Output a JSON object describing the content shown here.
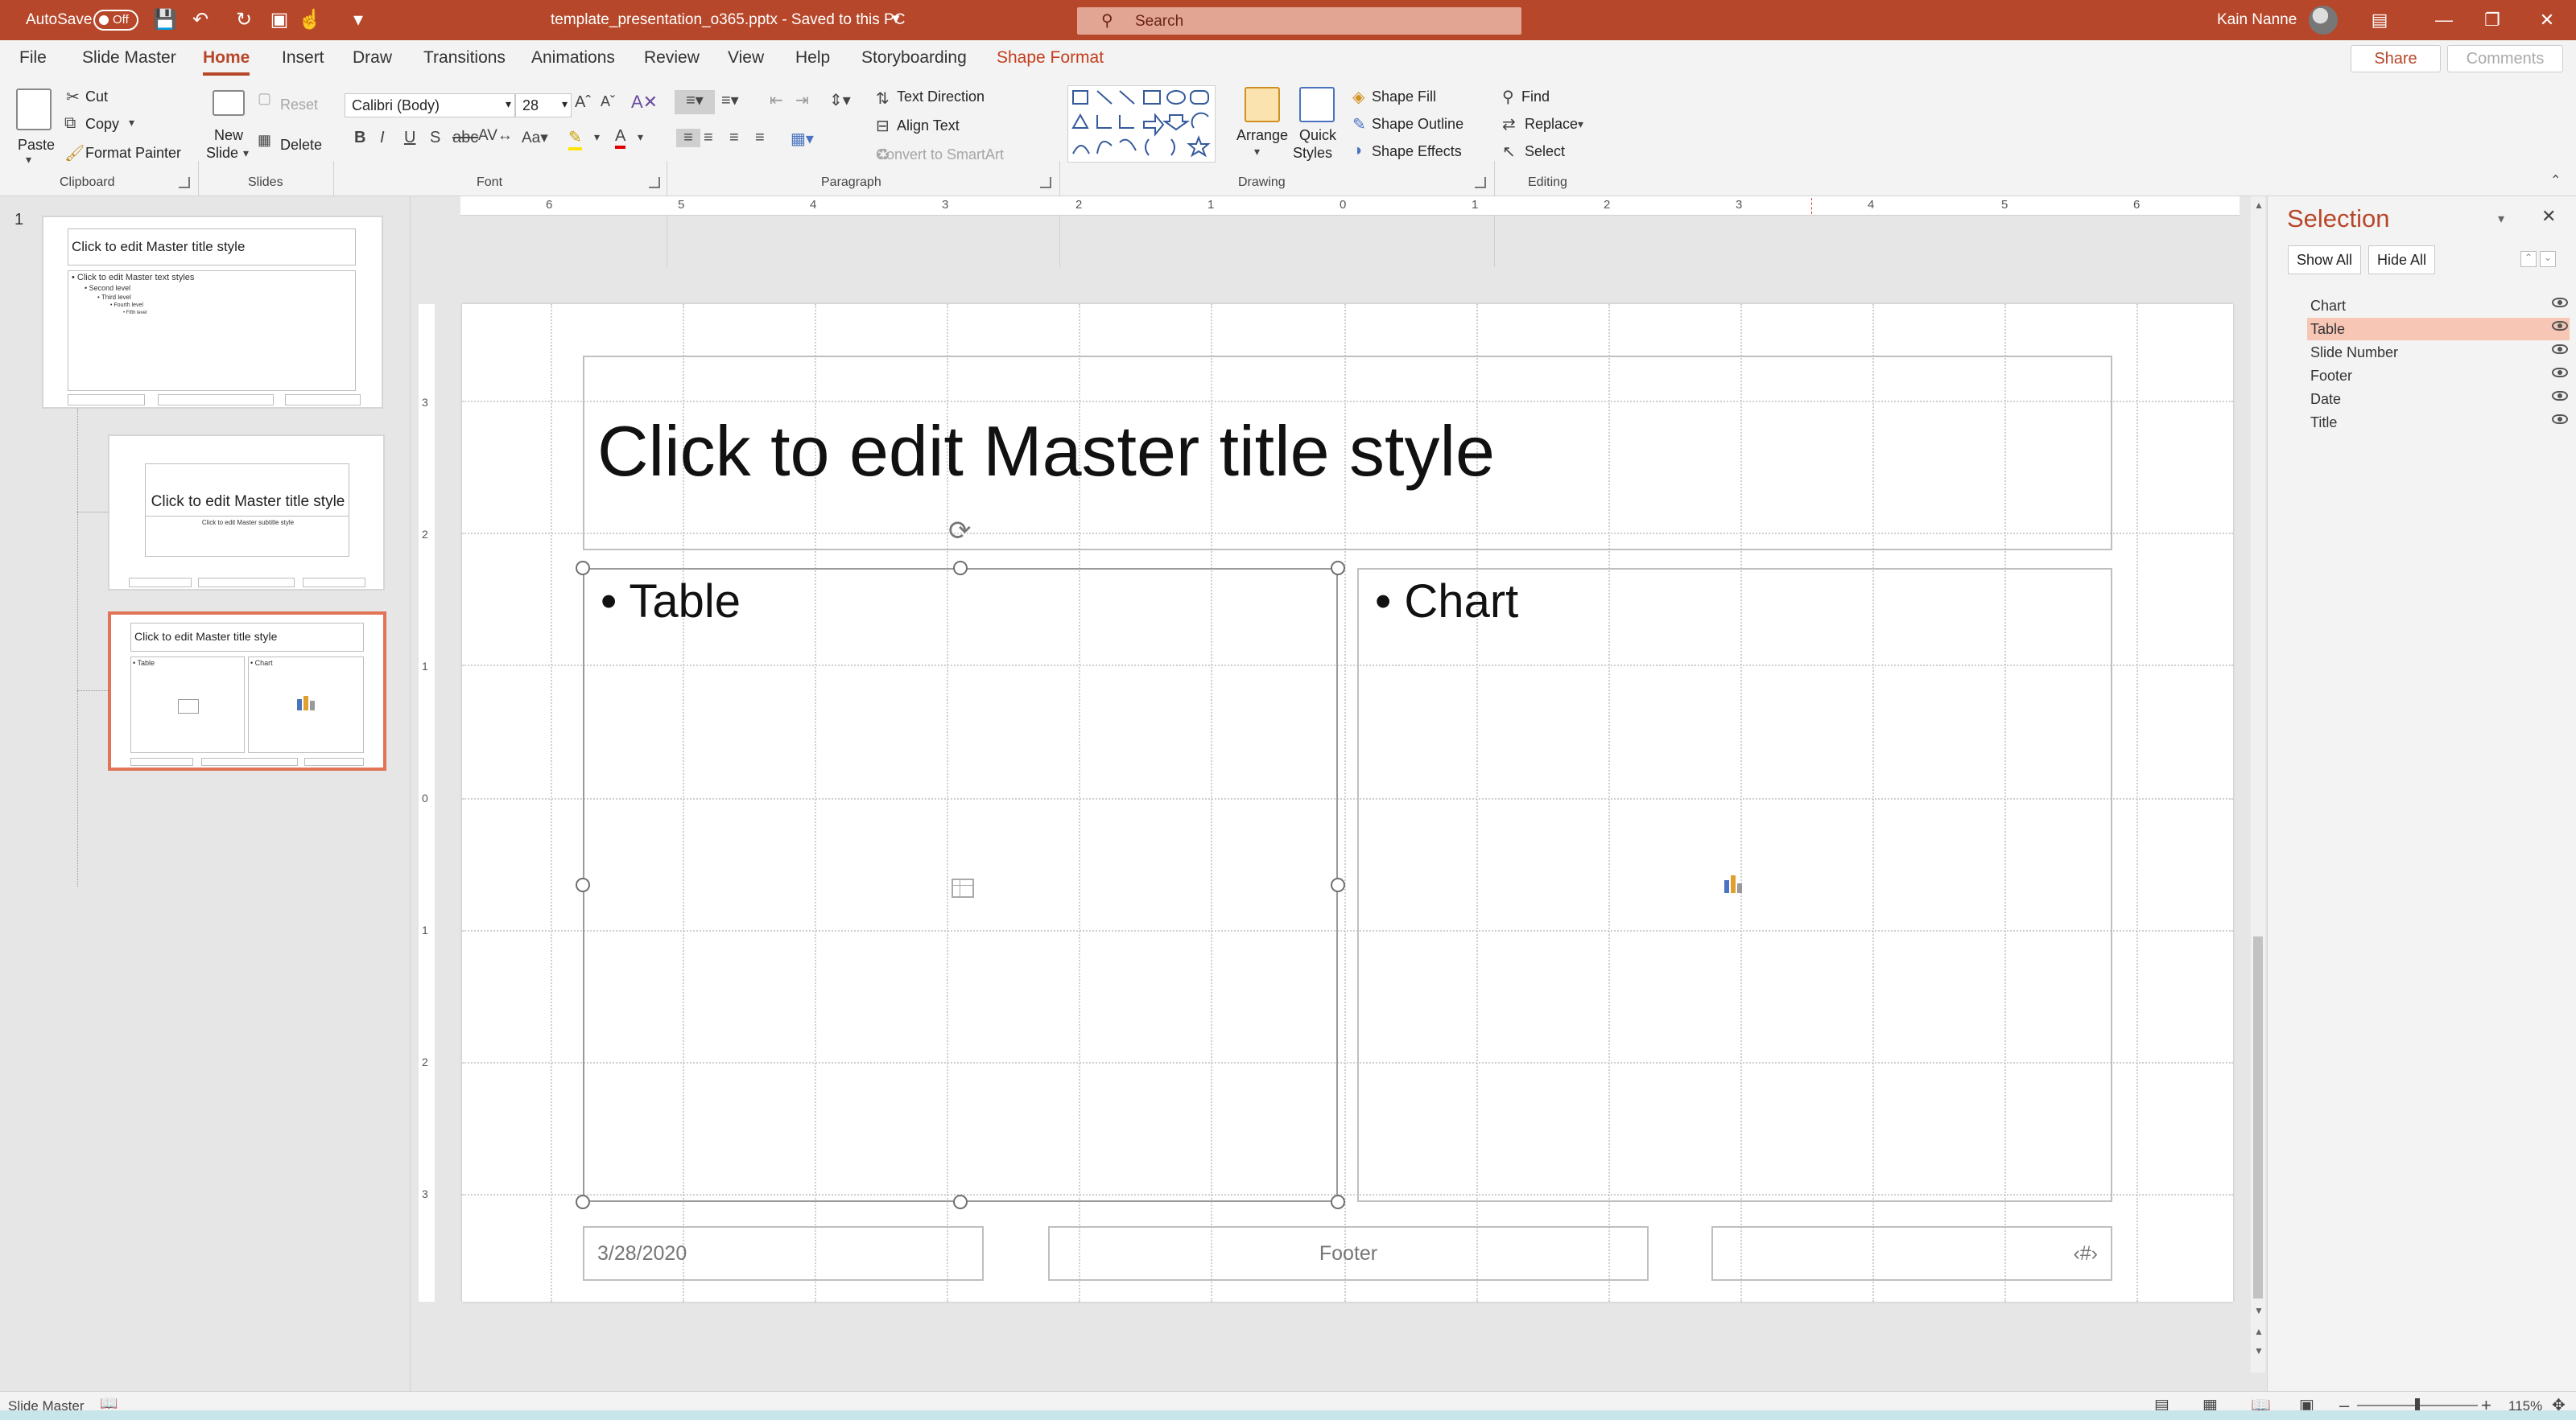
{
  "titlebar": {
    "autosave_label": "AutoSave",
    "autosave_state": "Off",
    "doc_title": "template_presentation_o365.pptx - Saved to this PC",
    "search_placeholder": "Search",
    "user_name": "Kain Nanne",
    "accent_color": "#b7472a"
  },
  "tabs": {
    "file": "File",
    "slide_master": "Slide Master",
    "home": "Home",
    "insert": "Insert",
    "draw": "Draw",
    "transitions": "Transitions",
    "animations": "Animations",
    "review": "Review",
    "view": "View",
    "help": "Help",
    "storyboarding": "Storyboarding",
    "shape_format": "Shape Format",
    "share": "Share",
    "comments": "Comments"
  },
  "ribbon": {
    "clipboard": {
      "paste": "Paste",
      "cut": "Cut",
      "copy": "Copy",
      "format_painter": "Format Painter",
      "label": "Clipboard"
    },
    "slides": {
      "new_slide": "New",
      "new_slide2": "Slide",
      "reset": "Reset",
      "delete": "Delete",
      "label": "Slides"
    },
    "font": {
      "family": "Calibri (Body)",
      "size": "28",
      "label": "Font"
    },
    "paragraph": {
      "text_direction": "Text Direction",
      "align_text": "Align Text",
      "convert_smartart": "Convert to SmartArt",
      "label": "Paragraph"
    },
    "drawing": {
      "arrange": "Arrange",
      "quick_styles": "Quick",
      "quick_styles2": "Styles",
      "shape_fill": "Shape Fill",
      "shape_outline": "Shape Outline",
      "shape_effects": "Shape Effects",
      "label": "Drawing"
    },
    "editing": {
      "find": "Find",
      "replace": "Replace",
      "select": "Select",
      "label": "Editing"
    }
  },
  "slides_panel": {
    "slide_number": "1",
    "thumb1": {
      "title": "Click to edit Master title style",
      "l1": "• Click to edit Master text styles",
      "l2": "• Second level",
      "l3": "• Third level",
      "l4": "• Fourth level",
      "l5": "• Fifth level"
    },
    "thumb2": {
      "title": "Click to edit Master title style",
      "subtitle": "Click to edit Master subtitle style"
    },
    "thumb3": {
      "title": "Click to edit Master title style",
      "left": "• Table",
      "right": "• Chart"
    }
  },
  "ruler": {
    "h_labels": [
      "6",
      "5",
      "4",
      "3",
      "2",
      "1",
      "0",
      "1",
      "2",
      "3",
      "4",
      "5",
      "6"
    ],
    "v_labels": [
      "3",
      "2",
      "1",
      "0",
      "1",
      "2",
      "3"
    ]
  },
  "slide": {
    "title": "Click to edit Master title style",
    "left_placeholder": "• Table",
    "right_placeholder": "• Chart",
    "date": "3/28/2020",
    "footer": "Footer",
    "slide_number": "‹#›"
  },
  "selection_pane": {
    "title": "Selection",
    "show_all": "Show All",
    "hide_all": "Hide All",
    "items": [
      "Chart",
      "Table",
      "Slide Number",
      "Footer",
      "Date",
      "Title"
    ],
    "selected": "Table"
  },
  "statusbar": {
    "view_name": "Slide Master",
    "zoom": "115%"
  }
}
